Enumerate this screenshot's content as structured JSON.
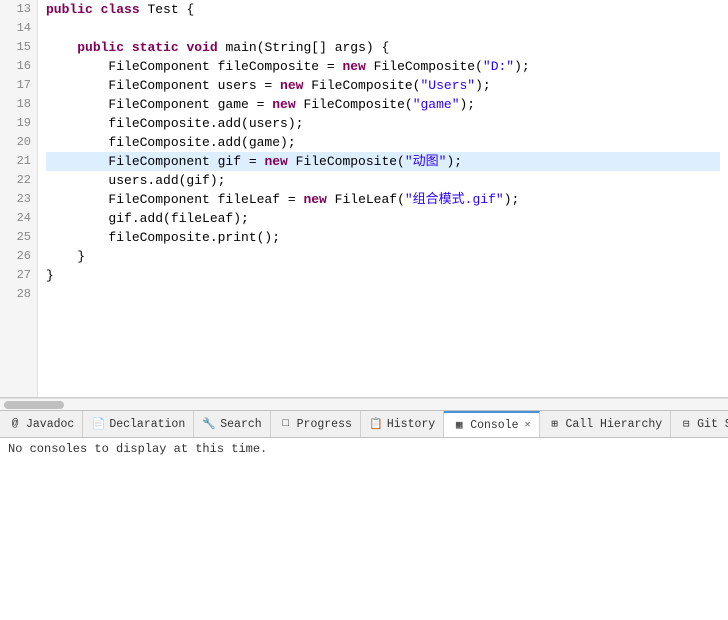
{
  "editor": {
    "lines": [
      {
        "num": "13",
        "content": [
          {
            "t": "kw",
            "v": "public"
          },
          {
            "t": "",
            "v": " "
          },
          {
            "t": "kw",
            "v": "class"
          },
          {
            "t": "",
            "v": " Test {"
          }
        ],
        "highlighted": false
      },
      {
        "num": "14",
        "content": [],
        "highlighted": false
      },
      {
        "num": "15",
        "content": [
          {
            "t": "",
            "v": "    "
          },
          {
            "t": "kw",
            "v": "public"
          },
          {
            "t": "",
            "v": " "
          },
          {
            "t": "kw",
            "v": "static"
          },
          {
            "t": "",
            "v": " "
          },
          {
            "t": "kw",
            "v": "void"
          },
          {
            "t": "",
            "v": " main(String[] args) {"
          }
        ],
        "highlighted": false
      },
      {
        "num": "16",
        "content": [
          {
            "t": "",
            "v": "        FileComponent fileComposite = "
          },
          {
            "t": "kw",
            "v": "new"
          },
          {
            "t": "",
            "v": " FileComposite("
          },
          {
            "t": "str",
            "v": "\"D:\""
          },
          {
            "t": "",
            "v": ");"
          }
        ],
        "highlighted": false
      },
      {
        "num": "17",
        "content": [
          {
            "t": "",
            "v": "        FileComponent users = "
          },
          {
            "t": "kw",
            "v": "new"
          },
          {
            "t": "",
            "v": " FileComposite("
          },
          {
            "t": "str",
            "v": "\"Users\""
          },
          {
            "t": "",
            "v": ");"
          }
        ],
        "highlighted": false
      },
      {
        "num": "18",
        "content": [
          {
            "t": "",
            "v": "        FileComponent game = "
          },
          {
            "t": "kw",
            "v": "new"
          },
          {
            "t": "",
            "v": " FileComposite("
          },
          {
            "t": "str",
            "v": "\"game\""
          },
          {
            "t": "",
            "v": ");"
          }
        ],
        "highlighted": false
      },
      {
        "num": "19",
        "content": [
          {
            "t": "",
            "v": "        fileComposite.add(users);"
          }
        ],
        "highlighted": false
      },
      {
        "num": "20",
        "content": [
          {
            "t": "",
            "v": "        fileComposite.add(game);"
          }
        ],
        "highlighted": false
      },
      {
        "num": "21",
        "content": [
          {
            "t": "",
            "v": "        FileComponent gif = "
          },
          {
            "t": "kw",
            "v": "new"
          },
          {
            "t": "",
            "v": " FileComposite("
          },
          {
            "t": "str-cn",
            "v": "\"动图\""
          },
          {
            "t": "",
            "v": ");"
          }
        ],
        "highlighted": true
      },
      {
        "num": "22",
        "content": [
          {
            "t": "",
            "v": "        users.add(gif);"
          }
        ],
        "highlighted": false
      },
      {
        "num": "23",
        "content": [
          {
            "t": "",
            "v": "        FileComponent fileLeaf = "
          },
          {
            "t": "kw",
            "v": "new"
          },
          {
            "t": "",
            "v": " FileLeaf("
          },
          {
            "t": "str-cn",
            "v": "\"组合模式.gif\""
          },
          {
            "t": "",
            "v": ");"
          }
        ],
        "highlighted": false
      },
      {
        "num": "24",
        "content": [
          {
            "t": "",
            "v": "        gif.add(fileLeaf);"
          }
        ],
        "highlighted": false
      },
      {
        "num": "25",
        "content": [
          {
            "t": "",
            "v": "        fileComposite.print();"
          }
        ],
        "highlighted": false
      },
      {
        "num": "26",
        "content": [
          {
            "t": "",
            "v": "    }"
          }
        ],
        "highlighted": false
      },
      {
        "num": "27",
        "content": [
          {
            "t": "",
            "v": "}"
          }
        ],
        "highlighted": false
      },
      {
        "num": "28",
        "content": [],
        "highlighted": false
      }
    ]
  },
  "tabs": [
    {
      "id": "javadoc",
      "icon": "@",
      "label": "Javadoc",
      "active": false,
      "closeable": false
    },
    {
      "id": "declaration",
      "icon": "☰",
      "label": "Declaration",
      "active": false,
      "closeable": false
    },
    {
      "id": "search",
      "icon": "🔍",
      "label": "Search",
      "active": false,
      "closeable": false
    },
    {
      "id": "progress",
      "icon": "⬜",
      "label": "Progress",
      "active": false,
      "closeable": false
    },
    {
      "id": "history",
      "icon": "📋",
      "label": "History",
      "active": false,
      "closeable": false
    },
    {
      "id": "console",
      "icon": "▦",
      "label": "Console",
      "active": true,
      "closeable": true
    },
    {
      "id": "call-hierarchy",
      "icon": "⊞",
      "label": "Call Hierarchy",
      "active": false,
      "closeable": false
    },
    {
      "id": "git-staging",
      "icon": "⊡",
      "label": "Git Staging",
      "active": false,
      "closeable": false
    }
  ],
  "console": {
    "message": "No consoles to display at this time."
  }
}
